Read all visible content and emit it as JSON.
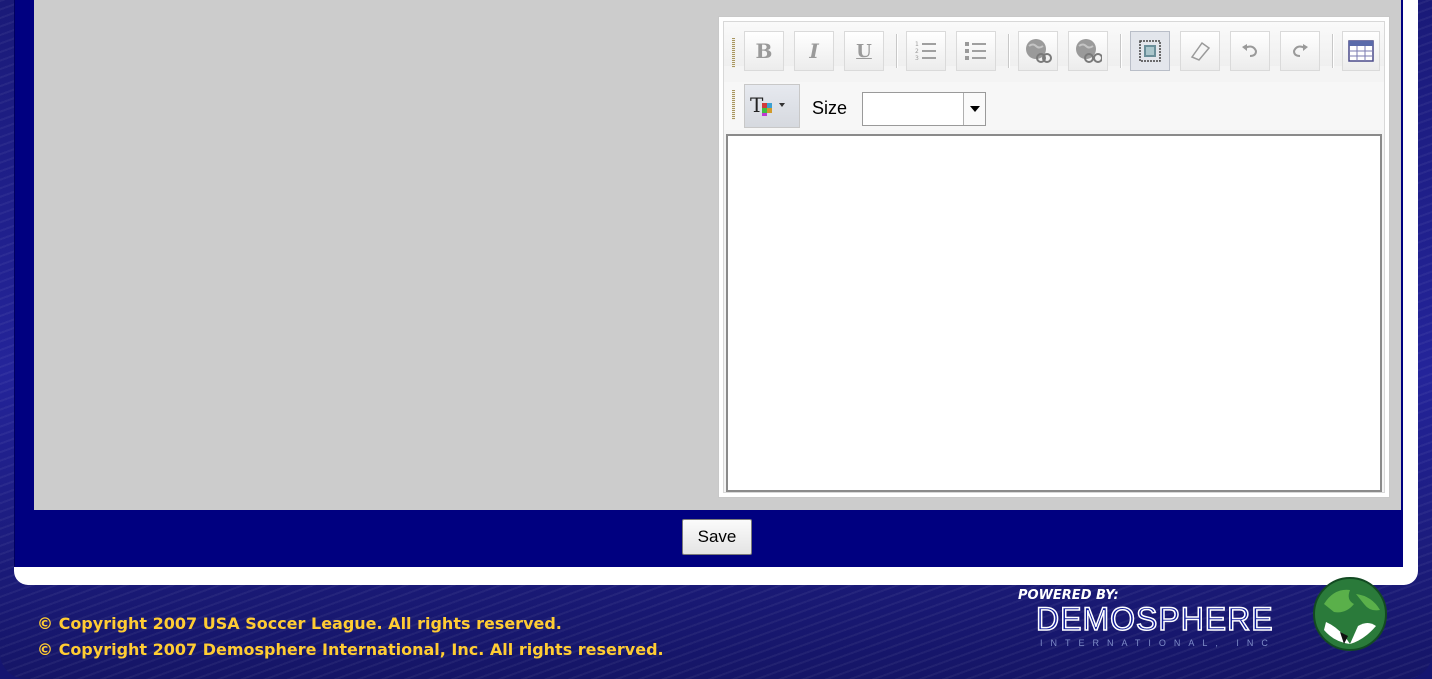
{
  "toolbar": {
    "row1_buttons": [
      {
        "name": "bold-button",
        "icon": "bold-icon",
        "glyph": "B"
      },
      {
        "name": "italic-button",
        "icon": "italic-icon",
        "glyph": "I"
      },
      {
        "name": "underline-button",
        "icon": "underline-icon",
        "glyph": "U"
      },
      {
        "name": "ordered-list-button",
        "icon": "ordered-list-icon"
      },
      {
        "name": "unordered-list-button",
        "icon": "unordered-list-icon"
      },
      {
        "name": "insert-link-button",
        "icon": "globe-link-icon"
      },
      {
        "name": "remove-link-button",
        "icon": "globe-unlink-icon"
      },
      {
        "name": "select-all-button",
        "icon": "select-all-icon"
      },
      {
        "name": "eraser-button",
        "icon": "eraser-icon"
      },
      {
        "name": "undo-button",
        "icon": "undo-icon"
      },
      {
        "name": "redo-button",
        "icon": "redo-icon"
      },
      {
        "name": "insert-table-button",
        "icon": "table-icon"
      }
    ],
    "size_label": "Size",
    "size_value": ""
  },
  "form": {
    "save_label": "Save"
  },
  "footer": {
    "copyright_league": "© Copyright 2007 USA Soccer League. All rights reserved.",
    "copyright_demosphere": "© Copyright 2007 Demosphere International, Inc. All rights reserved.",
    "powered_by": "POWERED BY:",
    "brand": "DEMOSPHERE",
    "brand_sub": "INTERNATIONAL, INC"
  },
  "colors": {
    "frame_navy": "#000080",
    "content_gray": "#cccccc",
    "footer_text": "#ffcc33"
  }
}
